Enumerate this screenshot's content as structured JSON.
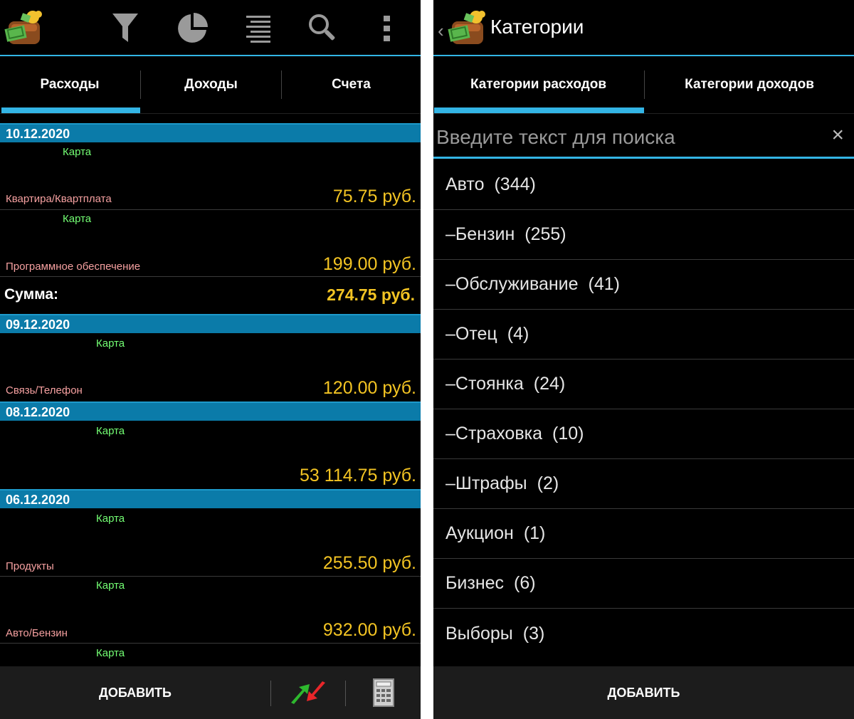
{
  "left": {
    "tabs": [
      "Расходы",
      "Доходы",
      "Счета"
    ],
    "groups": [
      {
        "date": "10.12.2020",
        "entries": [
          {
            "account": "Карта",
            "category": "Квартира/Квартплата",
            "amount": "75.75 руб."
          },
          {
            "account": "Карта",
            "category": "Программное обеспечение",
            "amount": "199.00 руб."
          }
        ]
      },
      {
        "sum_label": "Сумма:",
        "sum_value": "274.75 руб."
      },
      {
        "date": "09.12.2020",
        "entries": [
          {
            "account": "Карта",
            "category": "Связь/Телефон",
            "amount": "120.00 руб."
          }
        ]
      },
      {
        "date": "08.12.2020",
        "entries": [
          {
            "account": "Карта",
            "category": "",
            "amount": "53 114.75 руб."
          }
        ]
      },
      {
        "date": "06.12.2020",
        "entries": [
          {
            "account": "Карта",
            "category": "Продукты",
            "amount": "255.50 руб."
          },
          {
            "account": "Карта",
            "category": "Авто/Бензин",
            "amount": "932.00 руб."
          },
          {
            "account": "Карта"
          }
        ]
      }
    ],
    "bottom": {
      "add_label": "ДОБАВИТЬ"
    }
  },
  "right": {
    "title": "Категории",
    "tabs": [
      "Категории расходов",
      "Категории доходов"
    ],
    "search_placeholder": "Введите текст для поиска",
    "clear_icon": "×",
    "categories": [
      {
        "name": "Авто",
        "count": "(344)"
      },
      {
        "name": "–Бензин",
        "count": "(255)"
      },
      {
        "name": "–Обслуживание",
        "count": "(41)"
      },
      {
        "name": "–Отец",
        "count": "(4)"
      },
      {
        "name": "–Стоянка",
        "count": "(24)"
      },
      {
        "name": "–Страховка",
        "count": "(10)"
      },
      {
        "name": "–Штрафы",
        "count": "(2)"
      },
      {
        "name": "Аукцион",
        "count": "(1)"
      },
      {
        "name": "Бизнес",
        "count": "(6)"
      },
      {
        "name": "Выборы",
        "count": "(3)"
      }
    ],
    "bottom": {
      "add_label": "ДОБАВИТЬ"
    }
  },
  "icons": {
    "app": "wallet-money-icon",
    "filter": "filter-icon",
    "chart": "pie-chart-icon",
    "list": "list-icon",
    "search": "search-icon",
    "menu": "overflow-menu-icon",
    "transfer": "transfer-arrows-icon",
    "calculator": "calculator-icon"
  },
  "colors": {
    "accent": "#33b5e5",
    "date_header": "#0b7ba9",
    "amount": "#f3c423",
    "account": "#74ff74",
    "category": "#f5a0a0"
  }
}
